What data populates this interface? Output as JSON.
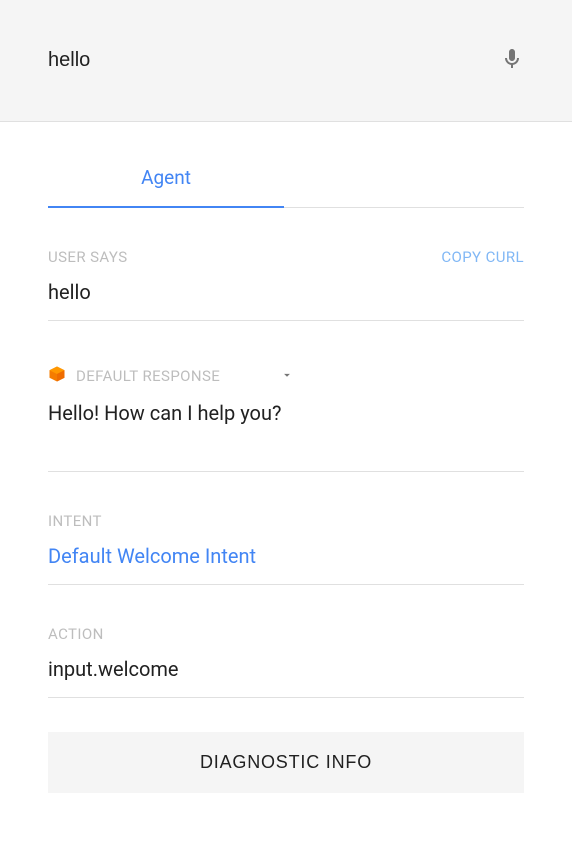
{
  "topbar": {
    "query": "hello"
  },
  "tabs": {
    "agent": "Agent"
  },
  "userSays": {
    "label": "USER SAYS",
    "copyCurl": "COPY CURL",
    "value": "hello"
  },
  "response": {
    "label": "DEFAULT RESPONSE",
    "text": "Hello! How can I help you?"
  },
  "intent": {
    "label": "INTENT",
    "value": "Default Welcome Intent"
  },
  "action": {
    "label": "ACTION",
    "value": "input.welcome"
  },
  "diagnostic": {
    "label": "DIAGNOSTIC INFO"
  }
}
